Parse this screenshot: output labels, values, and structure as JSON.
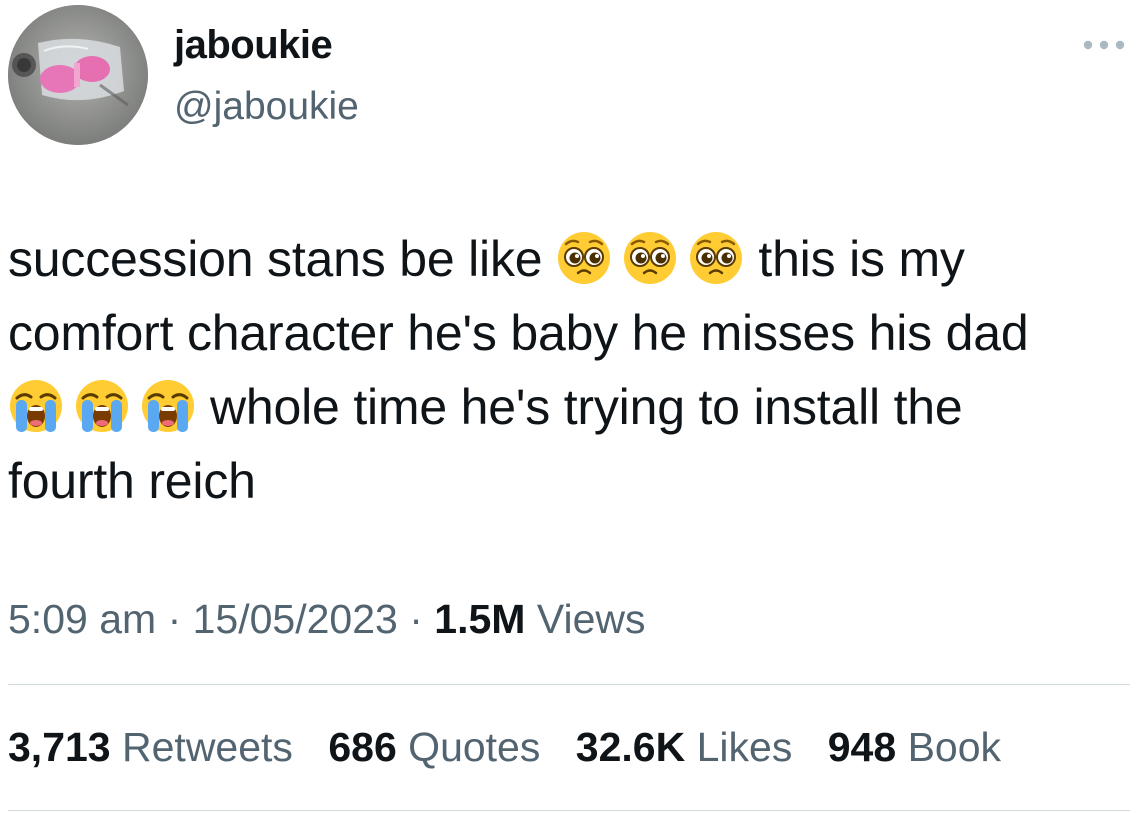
{
  "author": {
    "display_name": "jaboukie",
    "handle": "@jaboukie"
  },
  "tweet": {
    "lines": [
      {
        "text_before": "succession stans be like",
        "emojis": [
          "pleading-face-icon",
          "pleading-face-icon",
          "pleading-face-icon"
        ],
        "text_after": "this is my"
      },
      {
        "text": "comfort character he's baby he misses his dad"
      },
      {
        "emojis": [
          "loudly-crying-face-icon",
          "loudly-crying-face-icon",
          "loudly-crying-face-icon"
        ],
        "text_after": "whole time he's trying to install the"
      },
      {
        "text": "fourth reich"
      }
    ]
  },
  "meta": {
    "time": "5:09 am",
    "separator_1": "·",
    "date": "15/05/2023",
    "separator_2": "·",
    "views_count": "1.5M",
    "views_label": "Views"
  },
  "stats": {
    "retweets": {
      "count": "3,713",
      "label": "Retweets"
    },
    "quotes": {
      "count": "686",
      "label": "Quotes"
    },
    "likes": {
      "count": "32.6K",
      "label": "Likes"
    },
    "bookmarks": {
      "count": "948",
      "label": "Book"
    }
  },
  "colors": {
    "primary_text": "#0f1419",
    "secondary_text": "#536471",
    "divider": "#cfd9de",
    "emoji_face": "#ffcc33",
    "emoji_tear": "#5aa7f2"
  }
}
